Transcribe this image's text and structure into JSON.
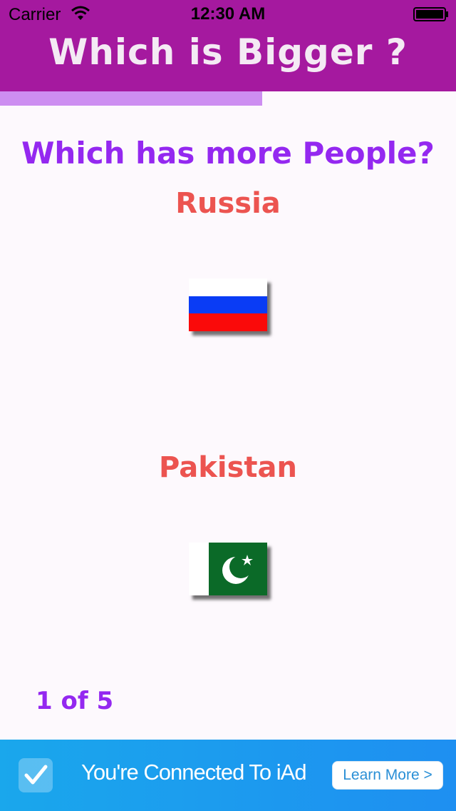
{
  "status_bar": {
    "carrier": "Carrier",
    "time": "12:30 AM"
  },
  "header": {
    "title": "Which is Bigger ?",
    "color": "#a5199f"
  },
  "progress": {
    "fraction": 0.575,
    "color": "#cd8ef1"
  },
  "question": {
    "text": "Which has more People?"
  },
  "countries": [
    {
      "name": "Russia",
      "flag": "russia-flag"
    },
    {
      "name": "Pakistan",
      "flag": "pakistan-flag"
    }
  ],
  "counter": {
    "text": "1 of 5"
  },
  "ad": {
    "text": "You're Connected To iAd",
    "button": "Learn More >",
    "icon": "checkmark-icon"
  },
  "colors": {
    "question": "#9428f0",
    "country_name": "#ec5450",
    "ad_background": "#1e8ff1"
  }
}
